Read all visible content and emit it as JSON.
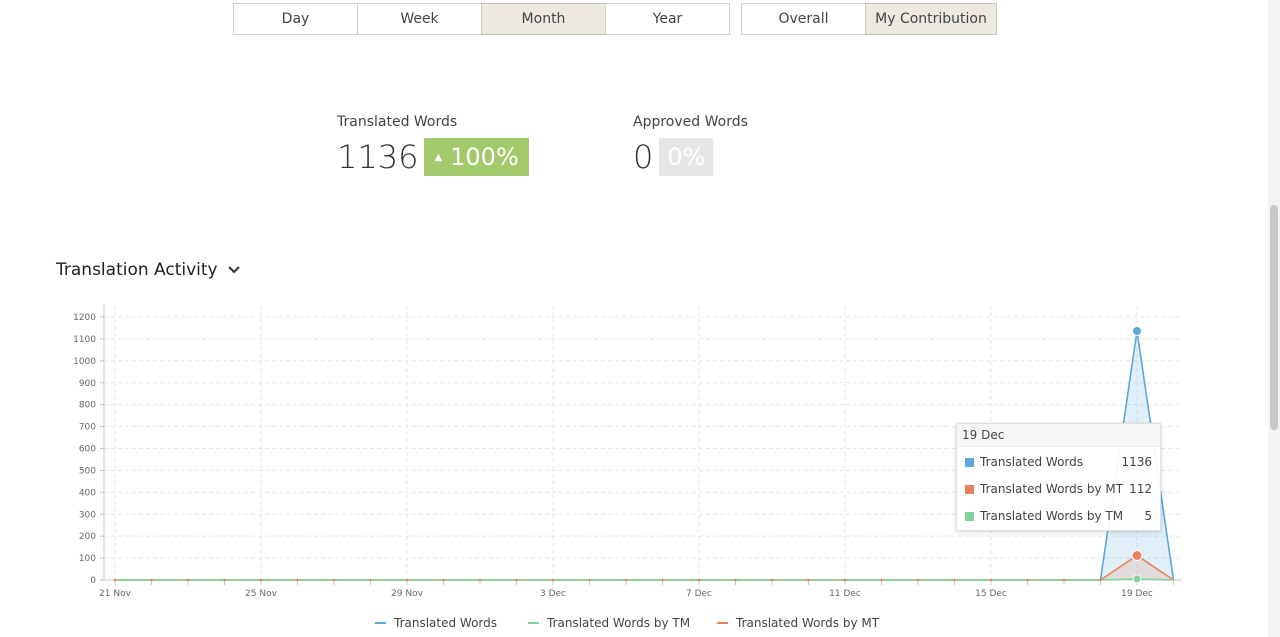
{
  "period_tabs": [
    {
      "label": "Day",
      "active": false
    },
    {
      "label": "Week",
      "active": false
    },
    {
      "label": "Month",
      "active": true
    },
    {
      "label": "Year",
      "active": false
    }
  ],
  "mode_tabs": [
    {
      "label": "Overall",
      "active": false
    },
    {
      "label": "My Contribution",
      "active": true
    }
  ],
  "stats": {
    "translated": {
      "label": "Translated Words",
      "value": "1136",
      "change": "100%"
    },
    "approved": {
      "label": "Approved Words",
      "value": "0",
      "change": "0%"
    }
  },
  "activity": {
    "title": "Translation Activity"
  },
  "tooltip": {
    "date": "19 Dec",
    "items": [
      {
        "name": "Translated Words",
        "value": "1136",
        "color": "#5aa8dc"
      },
      {
        "name": "Translated Words by MT",
        "value": "112",
        "color": "#e8825a"
      },
      {
        "name": "Translated Words by TM",
        "value": "5",
        "color": "#82d49a"
      }
    ]
  },
  "legend": [
    {
      "name": "Translated Words",
      "color": "#5aa8dc"
    },
    {
      "name": "Translated Words by TM",
      "color": "#82d49a"
    },
    {
      "name": "Translated Words by MT",
      "color": "#e8825a"
    }
  ],
  "colors": {
    "accent_green": "#a2c96a",
    "translated": "#5aa8dc",
    "mt": "#e8825a",
    "tm": "#82d49a"
  },
  "chart_data": {
    "type": "area",
    "x_labels": [
      "21 Nov",
      "25 Nov",
      "29 Nov",
      "3 Dec",
      "7 Dec",
      "11 Dec",
      "15 Dec",
      "19 Dec"
    ],
    "ylim": [
      0,
      1200
    ],
    "y_ticks": [
      0,
      100,
      200,
      300,
      400,
      500,
      600,
      700,
      800,
      900,
      1000,
      1100,
      1200
    ],
    "grid": true,
    "legend_position": "bottom",
    "x": [
      "21 Nov",
      "22 Nov",
      "23 Nov",
      "24 Nov",
      "25 Nov",
      "26 Nov",
      "27 Nov",
      "28 Nov",
      "29 Nov",
      "30 Nov",
      "1 Dec",
      "2 Dec",
      "3 Dec",
      "4 Dec",
      "5 Dec",
      "6 Dec",
      "7 Dec",
      "8 Dec",
      "9 Dec",
      "10 Dec",
      "11 Dec",
      "12 Dec",
      "13 Dec",
      "14 Dec",
      "15 Dec",
      "16 Dec",
      "17 Dec",
      "18 Dec",
      "19 Dec",
      "20 Dec"
    ],
    "series": [
      {
        "name": "Translated Words",
        "color": "#5aa8dc",
        "values": [
          0,
          0,
          0,
          0,
          0,
          0,
          0,
          0,
          0,
          0,
          0,
          0,
          0,
          0,
          0,
          0,
          0,
          0,
          0,
          0,
          0,
          0,
          0,
          0,
          0,
          0,
          0,
          0,
          1136,
          0
        ]
      },
      {
        "name": "Translated Words by MT",
        "color": "#e8825a",
        "values": [
          0,
          0,
          0,
          0,
          0,
          0,
          0,
          0,
          0,
          0,
          0,
          0,
          0,
          0,
          0,
          0,
          0,
          0,
          0,
          0,
          0,
          0,
          0,
          0,
          0,
          0,
          0,
          0,
          112,
          0
        ]
      },
      {
        "name": "Translated Words by TM",
        "color": "#82d49a",
        "values": [
          0,
          0,
          0,
          0,
          0,
          0,
          0,
          0,
          0,
          0,
          0,
          0,
          0,
          0,
          0,
          0,
          0,
          0,
          0,
          0,
          0,
          0,
          0,
          0,
          0,
          0,
          0,
          0,
          5,
          0
        ]
      }
    ]
  }
}
